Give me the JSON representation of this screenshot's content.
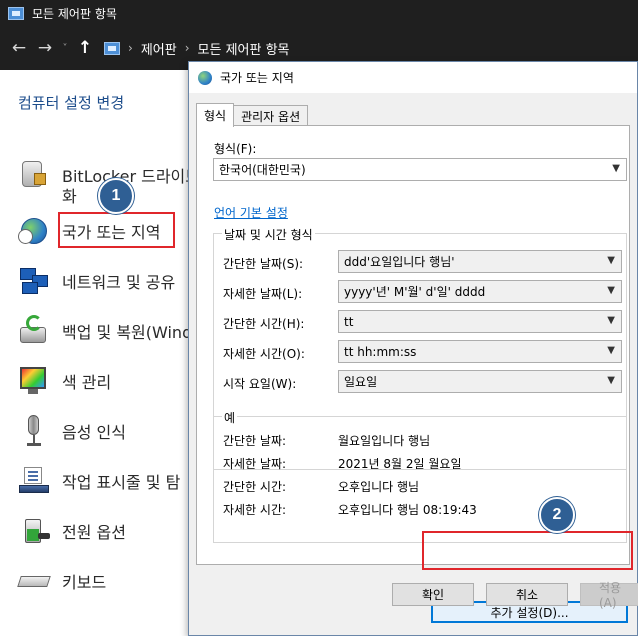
{
  "window": {
    "title": "모든 제어판 항목",
    "breadcrumb": [
      "제어판",
      "모든 제어판 항목"
    ]
  },
  "control_panel": {
    "heading": "컴퓨터 설정 변경",
    "items": [
      {
        "label": "BitLocker 드라이브",
        "label2": "화",
        "icon": "bitlocker-icon"
      },
      {
        "label": "국가 또는 지역",
        "icon": "globe-clock-icon"
      },
      {
        "label": "네트워크 및 공유",
        "icon": "network-icon"
      },
      {
        "label": "백업 및 복원(Wind",
        "icon": "backup-icon"
      },
      {
        "label": "색 관리",
        "icon": "color-management-icon"
      },
      {
        "label": "음성 인식",
        "icon": "microphone-icon"
      },
      {
        "label": "작업 표시줄 및 탐",
        "icon": "taskbar-icon"
      },
      {
        "label": "전원 옵션",
        "icon": "power-icon"
      },
      {
        "label": "키보드",
        "icon": "keyboard-icon"
      }
    ]
  },
  "annotations": {
    "badge1": "1",
    "badge2": "2",
    "highlight_color": "#e0262b",
    "badge_color": "#2f5f94"
  },
  "dialog": {
    "title": "국가 또는 지역",
    "tabs": [
      "형식",
      "관리자 옵션"
    ],
    "format_label": "형식(F):",
    "format_value": "한국어(대한민국)",
    "language_link": "언어 기본 설정",
    "datetime_group": "날짜 및 시간 형식",
    "datetime_rows": [
      {
        "label": "간단한 날짜(S):",
        "value": "ddd'요일입니다 행님'"
      },
      {
        "label": "자세한 날짜(L):",
        "value": "yyyy'년' M'월' d'일' dddd"
      },
      {
        "label": "간단한 시간(H):",
        "value": "tt"
      },
      {
        "label": "자세한 시간(O):",
        "value": "tt hh:mm:ss"
      },
      {
        "label": "시작 요일(W):",
        "value": "일요일"
      }
    ],
    "example_group": "예",
    "example_rows": [
      {
        "label": "간단한 날짜:",
        "value": "월요일입니다 행님"
      },
      {
        "label": "자세한 날짜:",
        "value": "2021년 8월 2일 월요일"
      },
      {
        "label": "간단한 시간:",
        "value": "오후입니다 행님"
      },
      {
        "label": "자세한 시간:",
        "value": "오후입니다 행님 08:19:43"
      }
    ],
    "additional_settings": "추가 설정(D)...",
    "ok": "확인",
    "cancel": "취소",
    "apply": "적용(A)"
  }
}
